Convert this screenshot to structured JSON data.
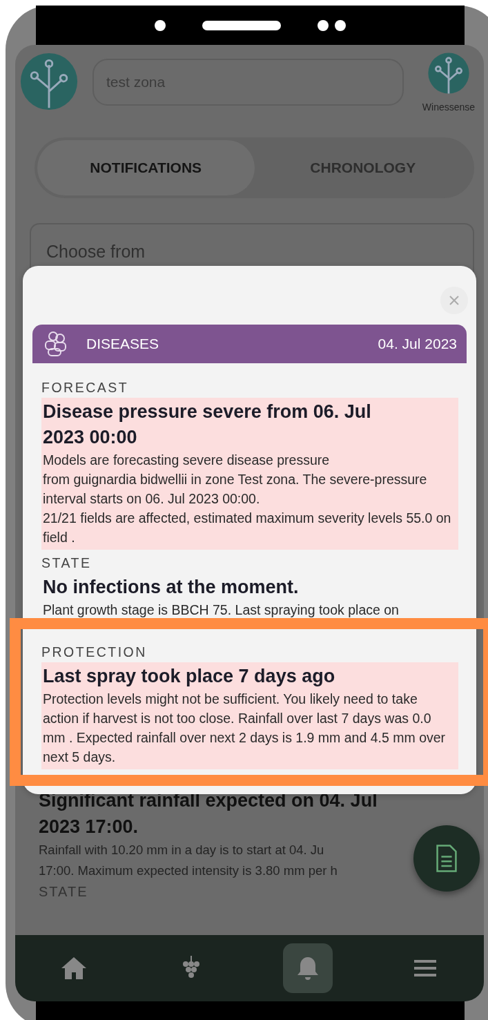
{
  "header": {
    "search": {
      "value": "test zona"
    },
    "brand": "Winessense"
  },
  "tabs": [
    {
      "label": "NOTIFICATIONS",
      "selected": true
    },
    {
      "label": "CHRONOLOGY",
      "selected": false
    }
  ],
  "filter": {
    "placeholder": "Choose from"
  },
  "background_notification": {
    "title": "Significant rainfall expected on 04. Jul 2023 17:00.",
    "lines": [
      "Rainfall with 10.20 mm in a day is to start at 04. Ju",
      "17:00. Maximum expected intensity is 3.80 mm per h"
    ],
    "next_label": "STATE"
  },
  "nav": [
    {
      "kind": "home",
      "selected": false
    },
    {
      "kind": "grapes",
      "selected": false
    },
    {
      "kind": "bell",
      "selected": true
    },
    {
      "kind": "menu",
      "selected": false
    }
  ],
  "modal": {
    "category": "DISEASES",
    "date": "04. Jul 2023",
    "sections": [
      {
        "label": "FORECAST",
        "title": "Disease pressure severe from 06. Jul 2023 00:00",
        "body": "Models are forecasting severe disease pressure\nfrom guignardia bidwellii in zone Test zona. The severe-pressure interval starts on 06. Jul 2023 00:00.\n21/21 fields are affected, estimated maximum severity levels 55.0 on field .",
        "alert": true,
        "highlighted": false
      },
      {
        "label": "STATE",
        "title": "No infections at the moment.",
        "body": "Plant growth stage is BBCH 75. Last spraying took place on",
        "alert": false,
        "highlighted": false
      },
      {
        "label": "PROTECTION",
        "title": "Last spray took place 7 days ago",
        "body": "Protection levels might not be sufficient. You likely need to take action if harvest is not too close. Rainfall over last 7 days was 0.0 mm . Expected rainfall over next 2 days is 1.9 mm and 4.5 mm over next 5 days.",
        "alert": true,
        "highlighted": true
      }
    ]
  }
}
